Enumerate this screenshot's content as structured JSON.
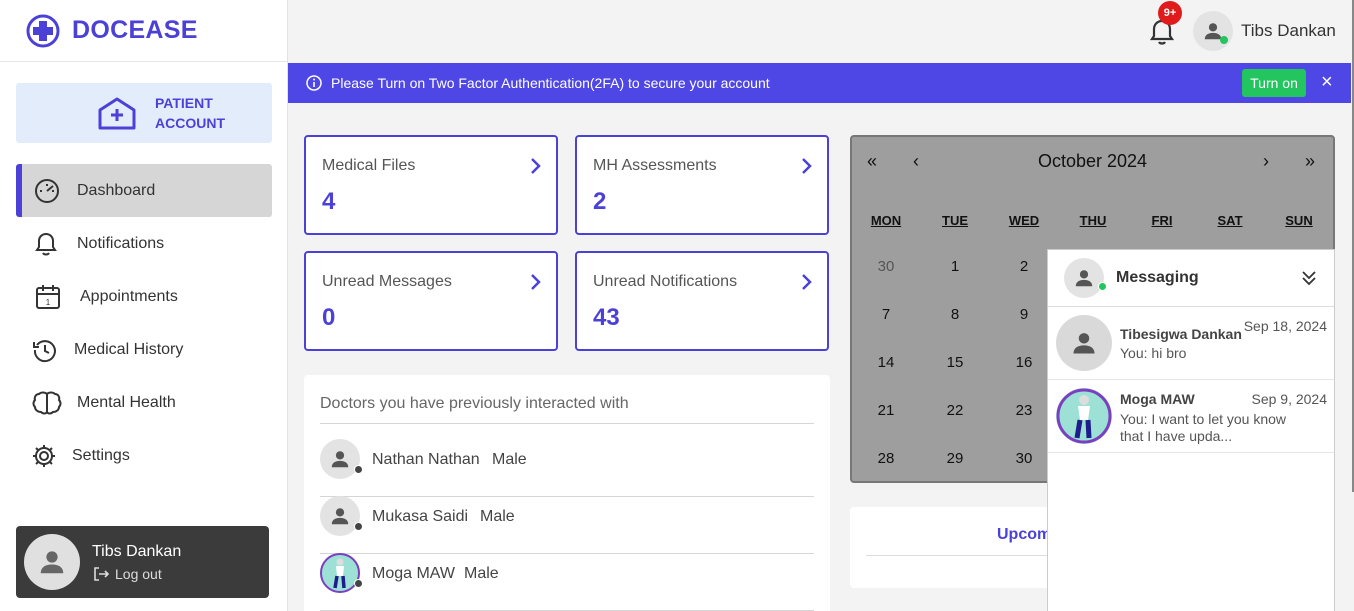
{
  "brand": {
    "name": "DOCEASE"
  },
  "account": {
    "line1": "PATIENT",
    "line2": "ACCOUNT"
  },
  "nav": [
    {
      "label": "Dashboard",
      "icon": "gauge-icon",
      "active": true
    },
    {
      "label": "Notifications",
      "icon": "bell-icon"
    },
    {
      "label": "Appointments",
      "icon": "calendar-icon"
    },
    {
      "label": "Medical History",
      "icon": "history-icon"
    },
    {
      "label": "Mental Health",
      "icon": "brain-icon"
    },
    {
      "label": "Settings",
      "icon": "gear-icon"
    }
  ],
  "sidebar_user": {
    "name": "Tibs Dankan",
    "logout": "Log out"
  },
  "topbar": {
    "badge": "9+",
    "user_name": "Tibs Dankan"
  },
  "banner": {
    "message": "Please Turn on Two Factor Authentication(2FA) to secure your account",
    "button": "Turn on",
    "close": "×"
  },
  "stats": [
    {
      "title": "Medical Files",
      "value": "4"
    },
    {
      "title": "MH Assessments",
      "value": "2"
    },
    {
      "title": "Unread Messages",
      "value": "0"
    },
    {
      "title": "Unread Notifications",
      "value": "43"
    }
  ],
  "doctors": {
    "title": "Doctors you have previously interacted with",
    "list": [
      {
        "name": "Nathan Nathan",
        "gender": "Male"
      },
      {
        "name": "Mukasa Saidi",
        "gender": "Male"
      },
      {
        "name": "Moga MAW",
        "gender": "Male"
      }
    ]
  },
  "calendar": {
    "first": "«",
    "prev": "‹",
    "next": "›",
    "last": "»",
    "month": "October 2024",
    "weekdays": [
      "MON",
      "TUE",
      "WED",
      "THU",
      "FRI",
      "SAT",
      "SUN"
    ],
    "rows": [
      [
        "30",
        "1",
        "2"
      ],
      [
        "7",
        "8",
        "9"
      ],
      [
        "14",
        "15",
        "16"
      ],
      [
        "21",
        "22",
        "23"
      ],
      [
        "28",
        "29",
        "30"
      ]
    ]
  },
  "upcoming": {
    "title": "Upcom"
  },
  "messaging": {
    "title": "Messaging",
    "conversations": [
      {
        "name": "Tibesigwa Dankan",
        "date": "Sep 18, 2024",
        "preview": "You: hi bro"
      },
      {
        "name": "Moga MAW",
        "date": "Sep 9, 2024",
        "preview": "You: I want to let you know that I have upda..."
      }
    ]
  },
  "colors": {
    "brand": "#4b41d6",
    "banner": "#4e46e5",
    "success": "#22c55e",
    "badge": "#e01b1b"
  }
}
